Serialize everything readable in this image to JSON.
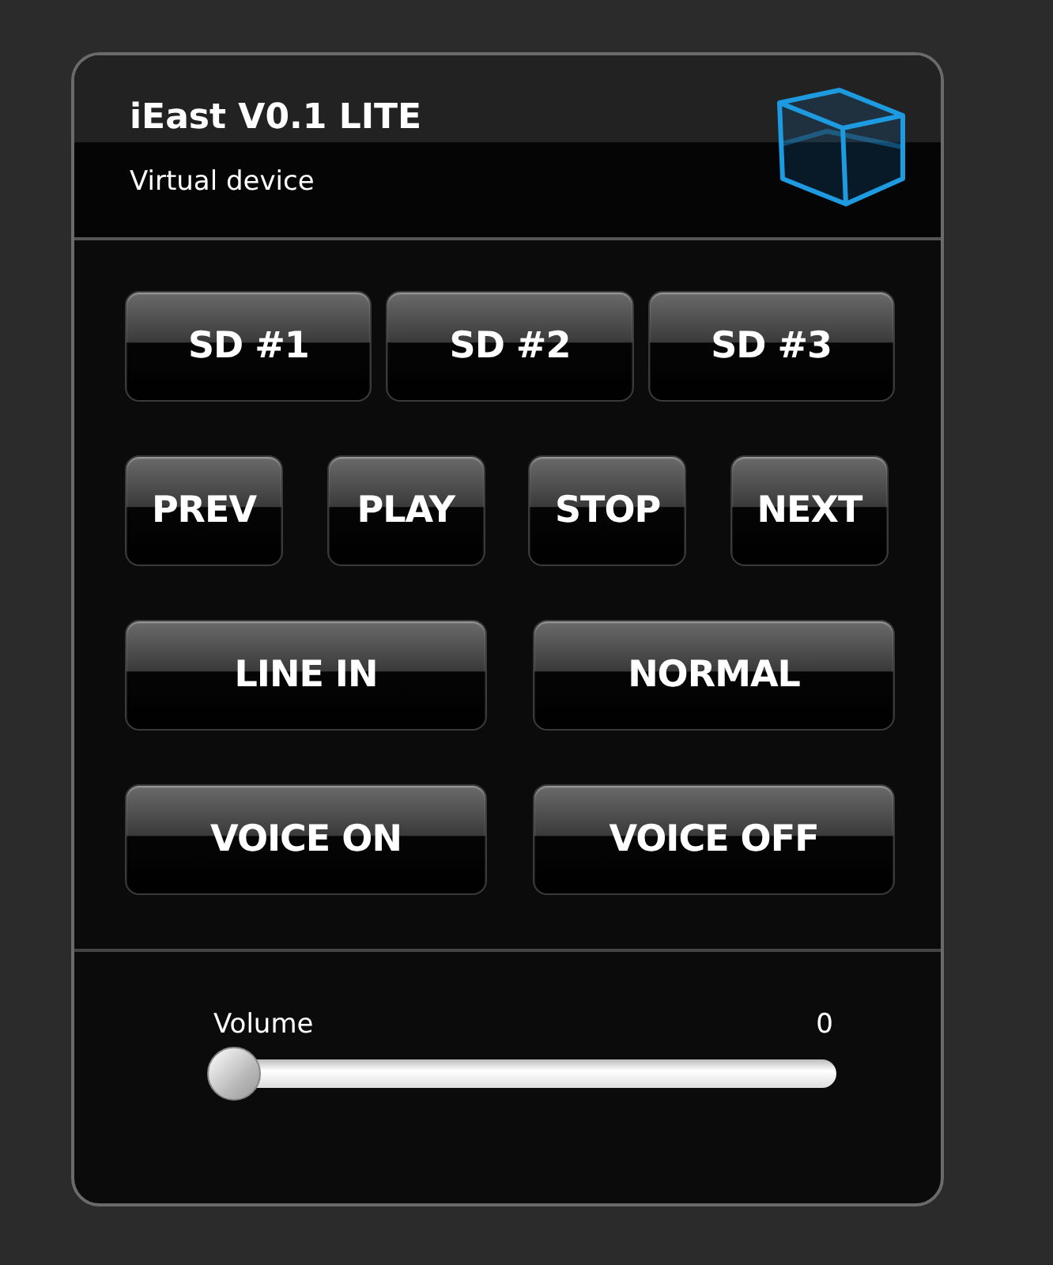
{
  "header": {
    "title": "iEast V0.1 LITE",
    "subtitle": "Virtual device"
  },
  "button_rows": [
    {
      "kind": "equal",
      "buttons": [
        "SD #1",
        "SD #2",
        "SD #3"
      ]
    },
    {
      "kind": "spread",
      "buttons": [
        "PREV",
        "PLAY",
        "STOP",
        "NEXT"
      ]
    },
    {
      "kind": "pair",
      "buttons": [
        "LINE IN",
        "NORMAL"
      ]
    },
    {
      "kind": "pair",
      "buttons": [
        "VOICE ON",
        "VOICE OFF"
      ]
    }
  ],
  "volume": {
    "label": "Volume",
    "reading": "0",
    "level": 0
  }
}
